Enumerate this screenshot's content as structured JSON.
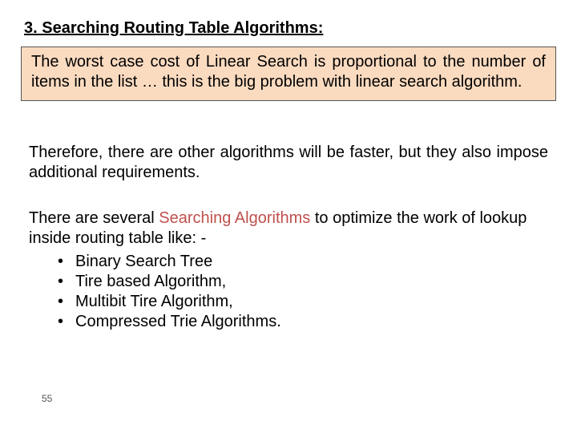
{
  "heading": "3. Searching Routing Table Algorithms:",
  "callout": "The worst case cost of Linear Search is proportional to the number of items in the list … this is the big problem with linear search algorithm.",
  "para_therefore": "Therefore, there are other algorithms will be faster, but they also impose additional requirements.",
  "para_several_pre": "There are several ",
  "para_several_highlight": "Searching Algorithms",
  "para_several_post": " to optimize the work of lookup inside routing table like: -",
  "bullets": {
    "b0": "Binary Search Tree",
    "b1": "Tire based Algorithm,",
    "b2": "Multibit Tire Algorithm,",
    "b3": "Compressed Trie Algorithms."
  },
  "page_number": "55"
}
